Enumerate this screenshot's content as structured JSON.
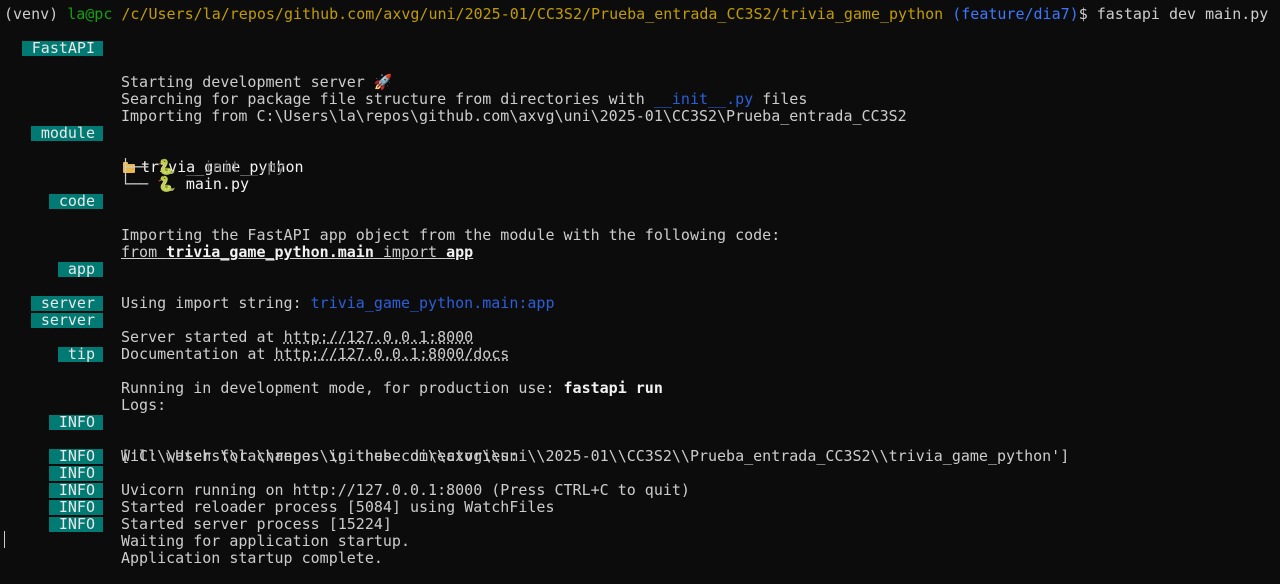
{
  "prompt": {
    "venv": "(venv)",
    "user": "la@pc",
    "path": "/c/Users/la/repos/github.com/axvg/uni/2025-01/CC3S2/Prueba_entrada_CC3S2/trivia_game_python",
    "branch": "(feature/dia7)",
    "symbol": "$",
    "command": "fastapi dev main.py"
  },
  "badges": {
    "fastapi": "FastAPI",
    "module": "module",
    "code": "code",
    "app": "app",
    "server": "server",
    "tip": "tip",
    "info": "INFO"
  },
  "lines": {
    "starting": "Starting development server 🚀",
    "searching_pre": "Searching for package file structure from directories with ",
    "searching_init": "__init__.py",
    "searching_post": " files",
    "importing_from": "Importing from C:\\Users\\la\\repos\\github.com\\axvg\\uni\\2025-01\\CC3S2\\Prueba_entrada_CC3S2",
    "module_folder": "trivia_game_python",
    "tree_init_prefix": "├──",
    "tree_init": "__init__.py",
    "tree_main_prefix": "└──",
    "tree_main": "main.py",
    "code_line": "Importing the FastAPI app object from the module with the following code:",
    "code_from": "from",
    "code_module": "trivia_game_python.main",
    "code_import": "import",
    "code_app": "app",
    "app_pre": "Using import string: ",
    "app_string": "trivia_game_python.main:app",
    "server1_pre": "Server started at ",
    "server1_url": "http://127.0.0.1:8000",
    "server2_pre": "Documentation at ",
    "server2_url": "http://127.0.0.1:8000/docs",
    "tip_pre": "Running in development mode, for production use: ",
    "tip_cmd": "fastapi run",
    "logs": "Logs:",
    "info1": "Will watch for changes in these directories:",
    "info1b": "['C:\\\\Users\\\\la\\\\repos\\\\github.com\\\\axvg\\\\uni\\\\2025-01\\\\CC3S2\\\\Prueba_entrada_CC3S2\\\\trivia_game_python']",
    "info2": "Uvicorn running on http://127.0.0.1:8000 (Press CTRL+C to quit)",
    "info3": "Started reloader process [5084] using WatchFiles",
    "info4": "Started server process [15224]",
    "info5": "Waiting for application startup.",
    "info6": "Application startup complete."
  },
  "icons": {
    "folder": "folder-icon",
    "python": "python-file-icon"
  }
}
